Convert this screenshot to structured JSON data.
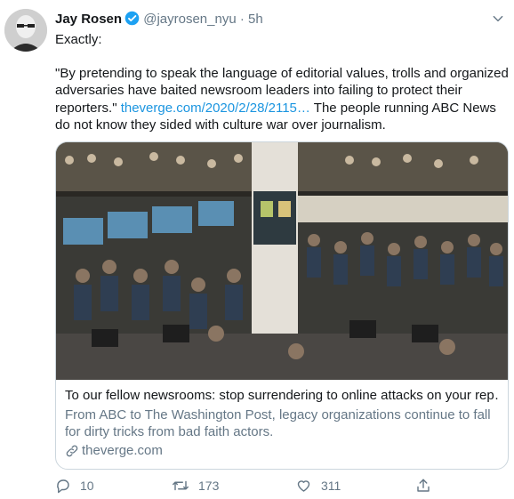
{
  "tweet": {
    "author_name": "Jay Rosen",
    "handle": "@jayrosen_nyu",
    "separator": "·",
    "time": "5h",
    "text_line1": "Exactly:",
    "quote": "\"By pretending to speak the language of editorial values, trolls and organized adversaries have baited newsroom leaders into failing to protect their reporters.\"",
    "link": "theverge.com/2020/2/28/2115…",
    "text_after_link": "The people running ABC News do not know they sided with culture war over journalism."
  },
  "card": {
    "title": "To our fellow newsrooms: stop surrendering to online attacks on your rep…",
    "description": "From ABC to The Washington Post, legacy organizations continue to fall for dirty tricks from bad faith actors.",
    "domain": "theverge.com"
  },
  "actions": {
    "reply_count": "10",
    "retweet_count": "173",
    "like_count": "311"
  },
  "colors": {
    "link": "#1b95e0",
    "secondary": "#657786",
    "verified": "#1da1f2"
  },
  "icons": [
    "verified-badge-icon",
    "caret-down-icon",
    "link-icon",
    "reply-icon",
    "retweet-icon",
    "like-icon",
    "share-icon"
  ]
}
